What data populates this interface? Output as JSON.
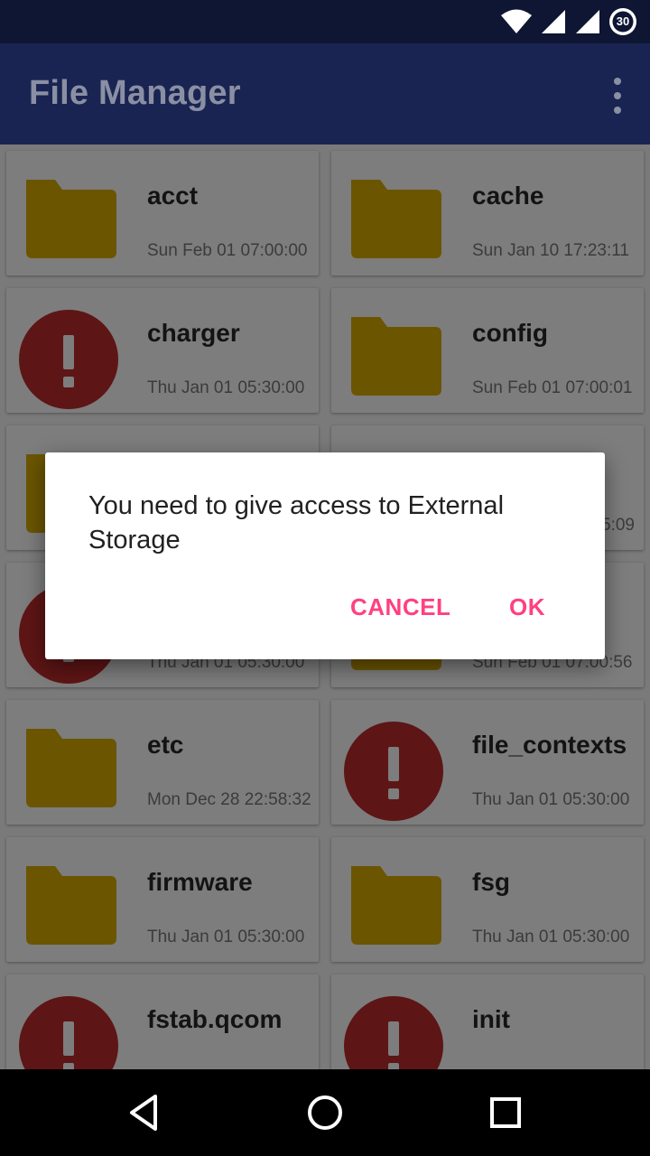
{
  "status_bar": {
    "battery_level": "30",
    "icons": [
      "wifi-icon",
      "signal-icon",
      "signal-icon",
      "battery-icon"
    ]
  },
  "app_bar": {
    "title": "File Manager",
    "overflow_icon": "more-vert-icon"
  },
  "files": [
    {
      "name": "acct",
      "date": "Sun Feb 01 07:00:00",
      "icon": "folder-icon"
    },
    {
      "name": "cache",
      "date": "Sun Jan 10 17:23:11",
      "icon": "folder-icon"
    },
    {
      "name": "charger",
      "date": "Thu Jan 01 05:30:00",
      "icon": "error-icon"
    },
    {
      "name": "config",
      "date": "Sun Feb 01 07:00:01",
      "icon": "folder-icon"
    },
    {
      "name": "",
      "date": "",
      "icon": "folder-icon"
    },
    {
      "name": "",
      "date": "5:09",
      "icon": "folder-icon"
    },
    {
      "name": "",
      "date": "Thu Jan 01 05:30:00",
      "icon": "error-icon"
    },
    {
      "name": "",
      "date": "Sun Feb 01 07:00:56",
      "icon": "folder-icon"
    },
    {
      "name": "etc",
      "date": "Mon Dec 28 22:58:32",
      "icon": "folder-icon"
    },
    {
      "name": "file_contexts",
      "date": "Thu Jan 01 05:30:00",
      "icon": "error-icon"
    },
    {
      "name": "firmware",
      "date": "Thu Jan 01 05:30:00",
      "icon": "folder-icon"
    },
    {
      "name": "fsg",
      "date": "Thu Jan 01 05:30:00",
      "icon": "folder-icon"
    },
    {
      "name": "fstab.qcom",
      "date": "",
      "icon": "error-icon"
    },
    {
      "name": "init",
      "date": "",
      "icon": "error-icon"
    }
  ],
  "dialog": {
    "message": "You need to give access to External Storage",
    "cancel_label": "CANCEL",
    "ok_label": "OK"
  },
  "nav_bar": {
    "icons": [
      "back-icon",
      "home-icon",
      "recents-icon"
    ]
  },
  "colors": {
    "app_bar": "#1a2452",
    "status_bar": "#0f1633",
    "folder": "#6b5500",
    "error": "#5e1515",
    "accent": "#ff4081"
  }
}
